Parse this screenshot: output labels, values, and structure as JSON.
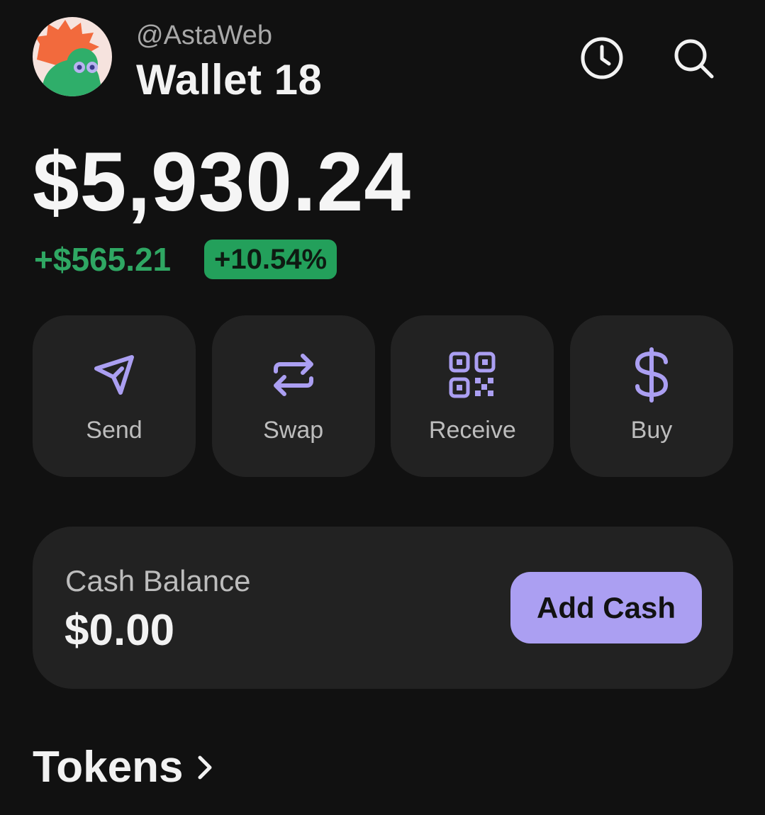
{
  "header": {
    "handle": "@AstaWeb",
    "wallet_name": "Wallet 18",
    "icons": [
      "avatar",
      "history-icon",
      "search-icon"
    ]
  },
  "portfolio": {
    "balance": "$5,930.24",
    "change_amount": "+$565.21",
    "change_percent": "+10.54%",
    "change_color": "#2fa763"
  },
  "actions": [
    {
      "label": "Send",
      "icon": "send-icon"
    },
    {
      "label": "Swap",
      "icon": "swap-icon"
    },
    {
      "label": "Receive",
      "icon": "qr-code-icon"
    },
    {
      "label": "Buy",
      "icon": "dollar-icon"
    }
  ],
  "cash": {
    "label": "Cash Balance",
    "value": "$0.00",
    "button_label": "Add Cash",
    "button_color": "#ab9ff2"
  },
  "tokens": {
    "title": "Tokens",
    "icon": "chevron-right-icon"
  },
  "colors": {
    "background": "#111111",
    "card": "#222222",
    "accent": "#ab9ff2",
    "positive": "#2fa763"
  }
}
